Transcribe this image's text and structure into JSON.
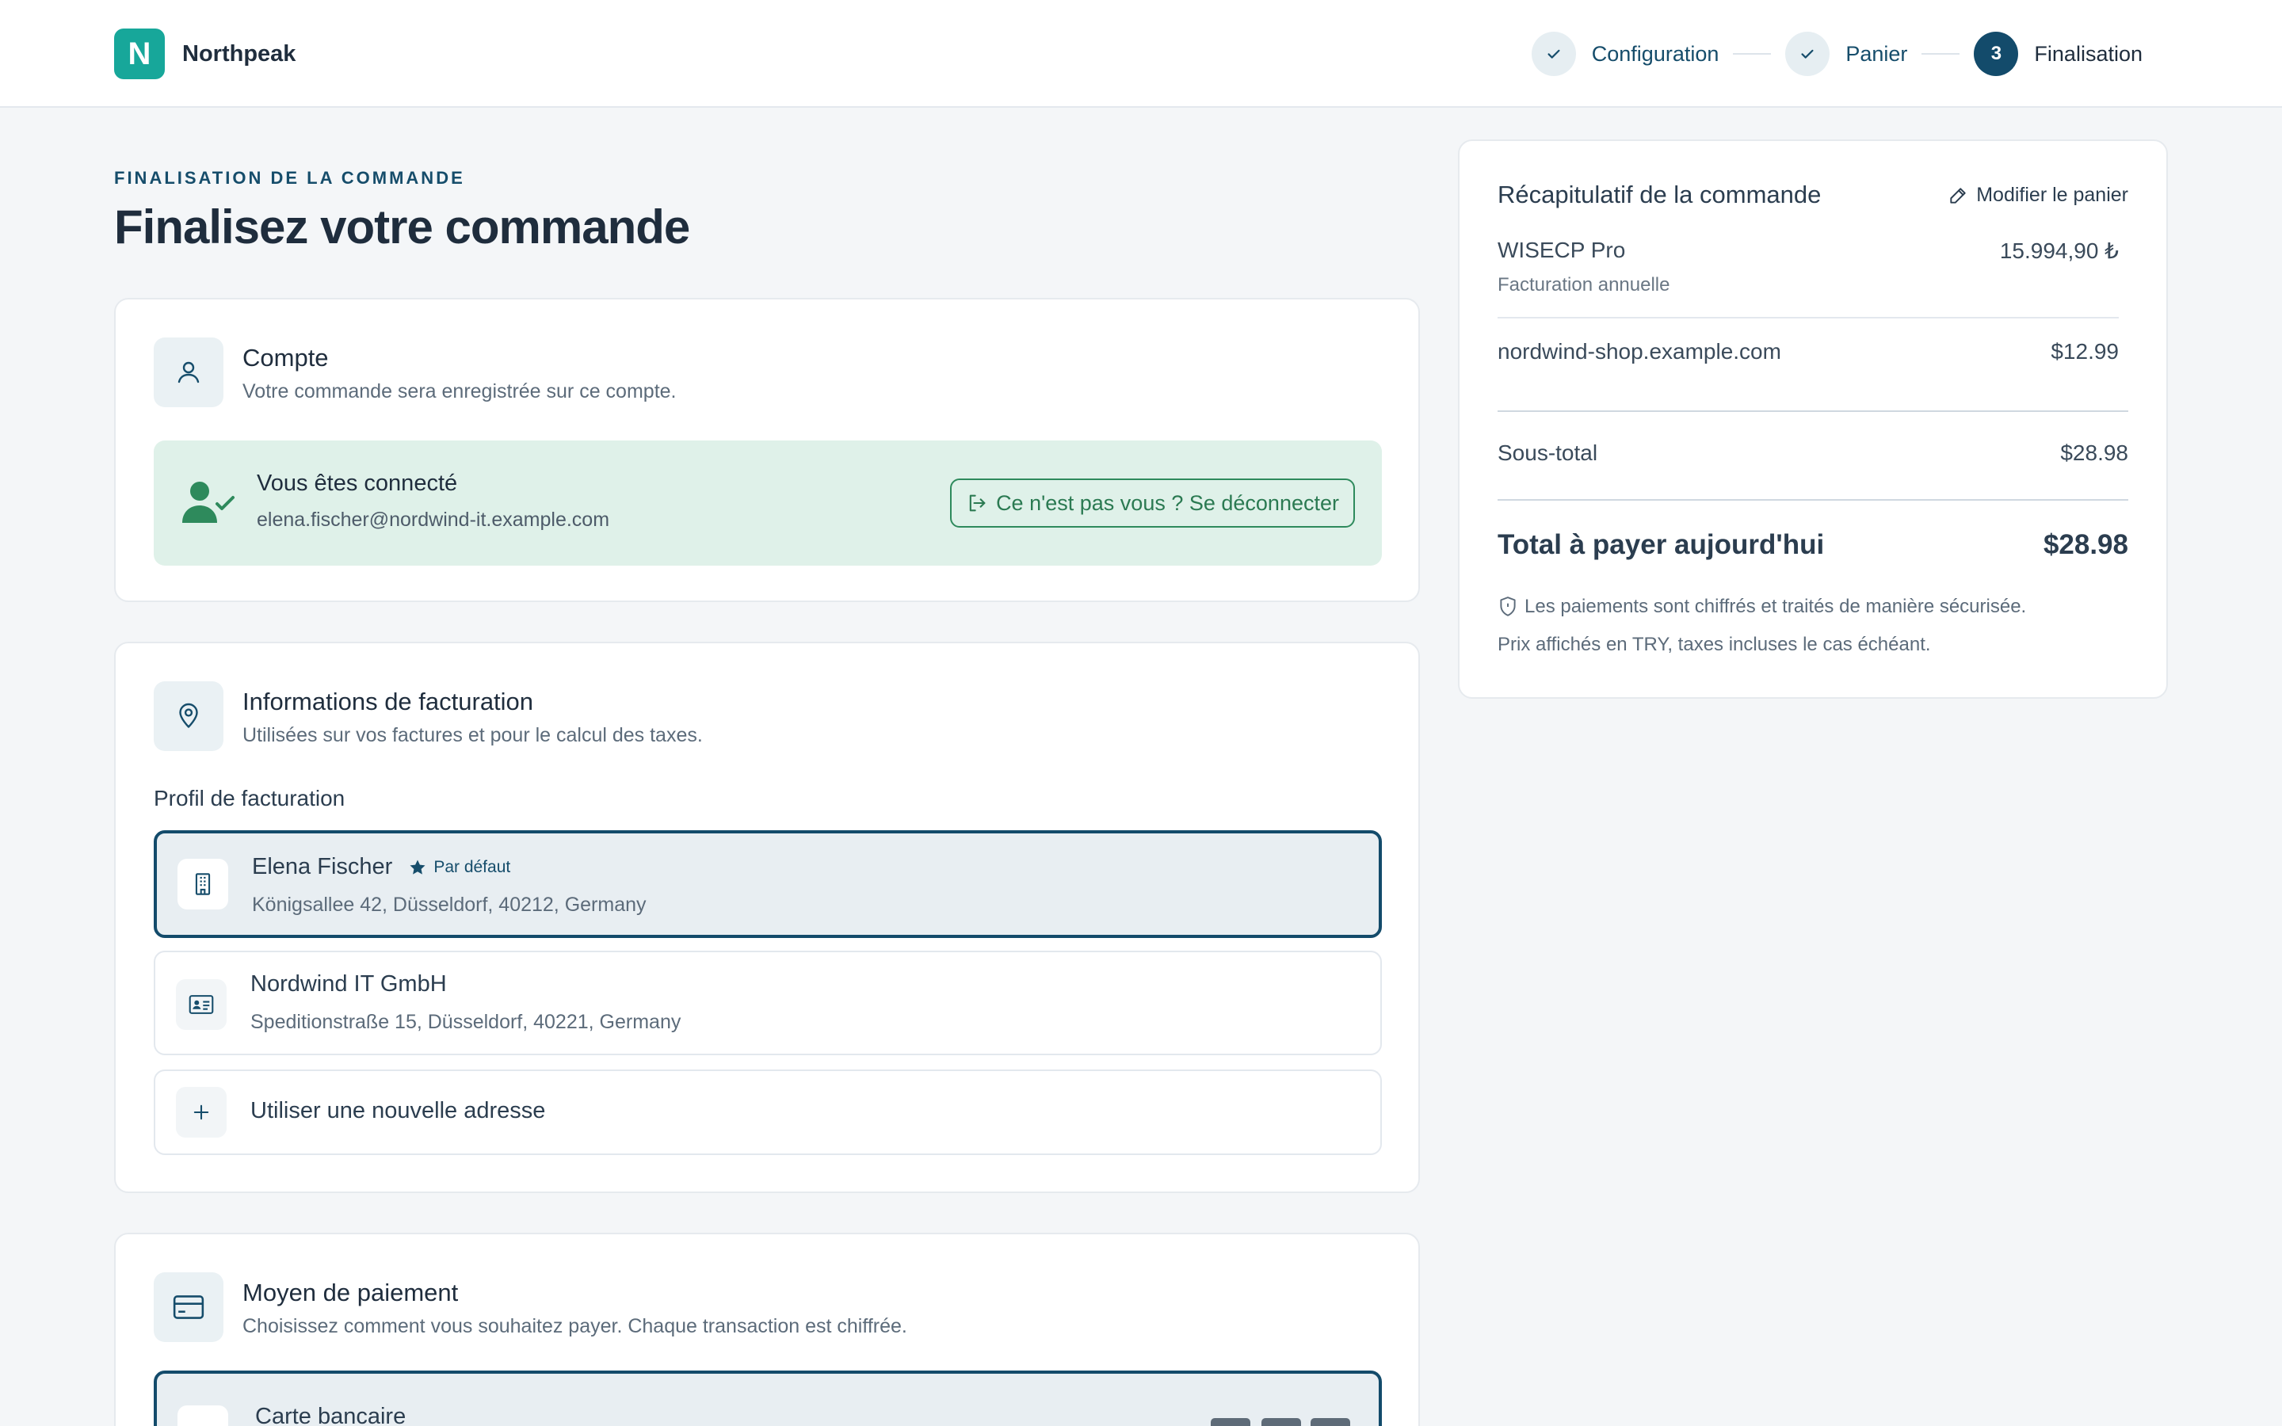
{
  "brand": {
    "initial": "N",
    "name": "Northpeak",
    "color": "#17a79a"
  },
  "steps": [
    {
      "label": "Configuration",
      "state": "done",
      "icon": "check-icon"
    },
    {
      "label": "Panier",
      "state": "done",
      "icon": "check-icon"
    },
    {
      "number": "3",
      "label": "Finalisation",
      "state": "active"
    }
  ],
  "page": {
    "eyebrow": "FINALISATION DE LA COMMANDE",
    "title": "Finalisez votre commande"
  },
  "account": {
    "title": "Compte",
    "subtitle": "Votre commande sera enregistrée sur ce compte.",
    "icon": "user-icon",
    "connected_title": "Vous êtes connecté",
    "email": "elena.fischer@nordwind-it.example.com",
    "logout_label": "Ce n'est pas vous ? Se déconnecter"
  },
  "billing": {
    "title": "Informations de facturation",
    "subtitle": "Utilisées sur vos factures et pour le calcul des taxes.",
    "icon": "map-pin-icon",
    "profile_label": "Profil de facturation",
    "profiles": [
      {
        "name": "Elena Fischer",
        "badge": "Par défaut",
        "address": "Königsallee 42, Düsseldorf, 40212, Germany",
        "icon": "building-icon",
        "selected": true
      },
      {
        "name": "Nordwind IT GmbH",
        "address": "Speditionstraße 15, Düsseldorf, 40221, Germany",
        "icon": "id-card-icon",
        "selected": false
      }
    ],
    "new_address_label": "Utiliser une nouvelle adresse"
  },
  "payment": {
    "title": "Moyen de paiement",
    "subtitle": "Choisissez comment vous souhaitez payer. Chaque transaction est chiffrée.",
    "icon": "credit-card-icon",
    "method_label": "Carte bancaire"
  },
  "summary": {
    "title": "Récapitulatif de la commande",
    "edit_label": "Modifier le panier",
    "items": [
      {
        "name": "WISECP Pro",
        "detail": "Facturation annuelle",
        "amount": "15.994,90 ₺"
      },
      {
        "name": "nordwind-shop.example.com",
        "amount": "$12.99"
      }
    ],
    "subtotal_label": "Sous-total",
    "subtotal": "$28.98",
    "total_label": "Total à payer aujourd'hui",
    "total": "$28.98",
    "secure_note": "Les paiements sont chiffrés et traités de manière sécurisée.",
    "currency_note": "Prix affichés en TRY, taxes incluses le cas échéant."
  }
}
